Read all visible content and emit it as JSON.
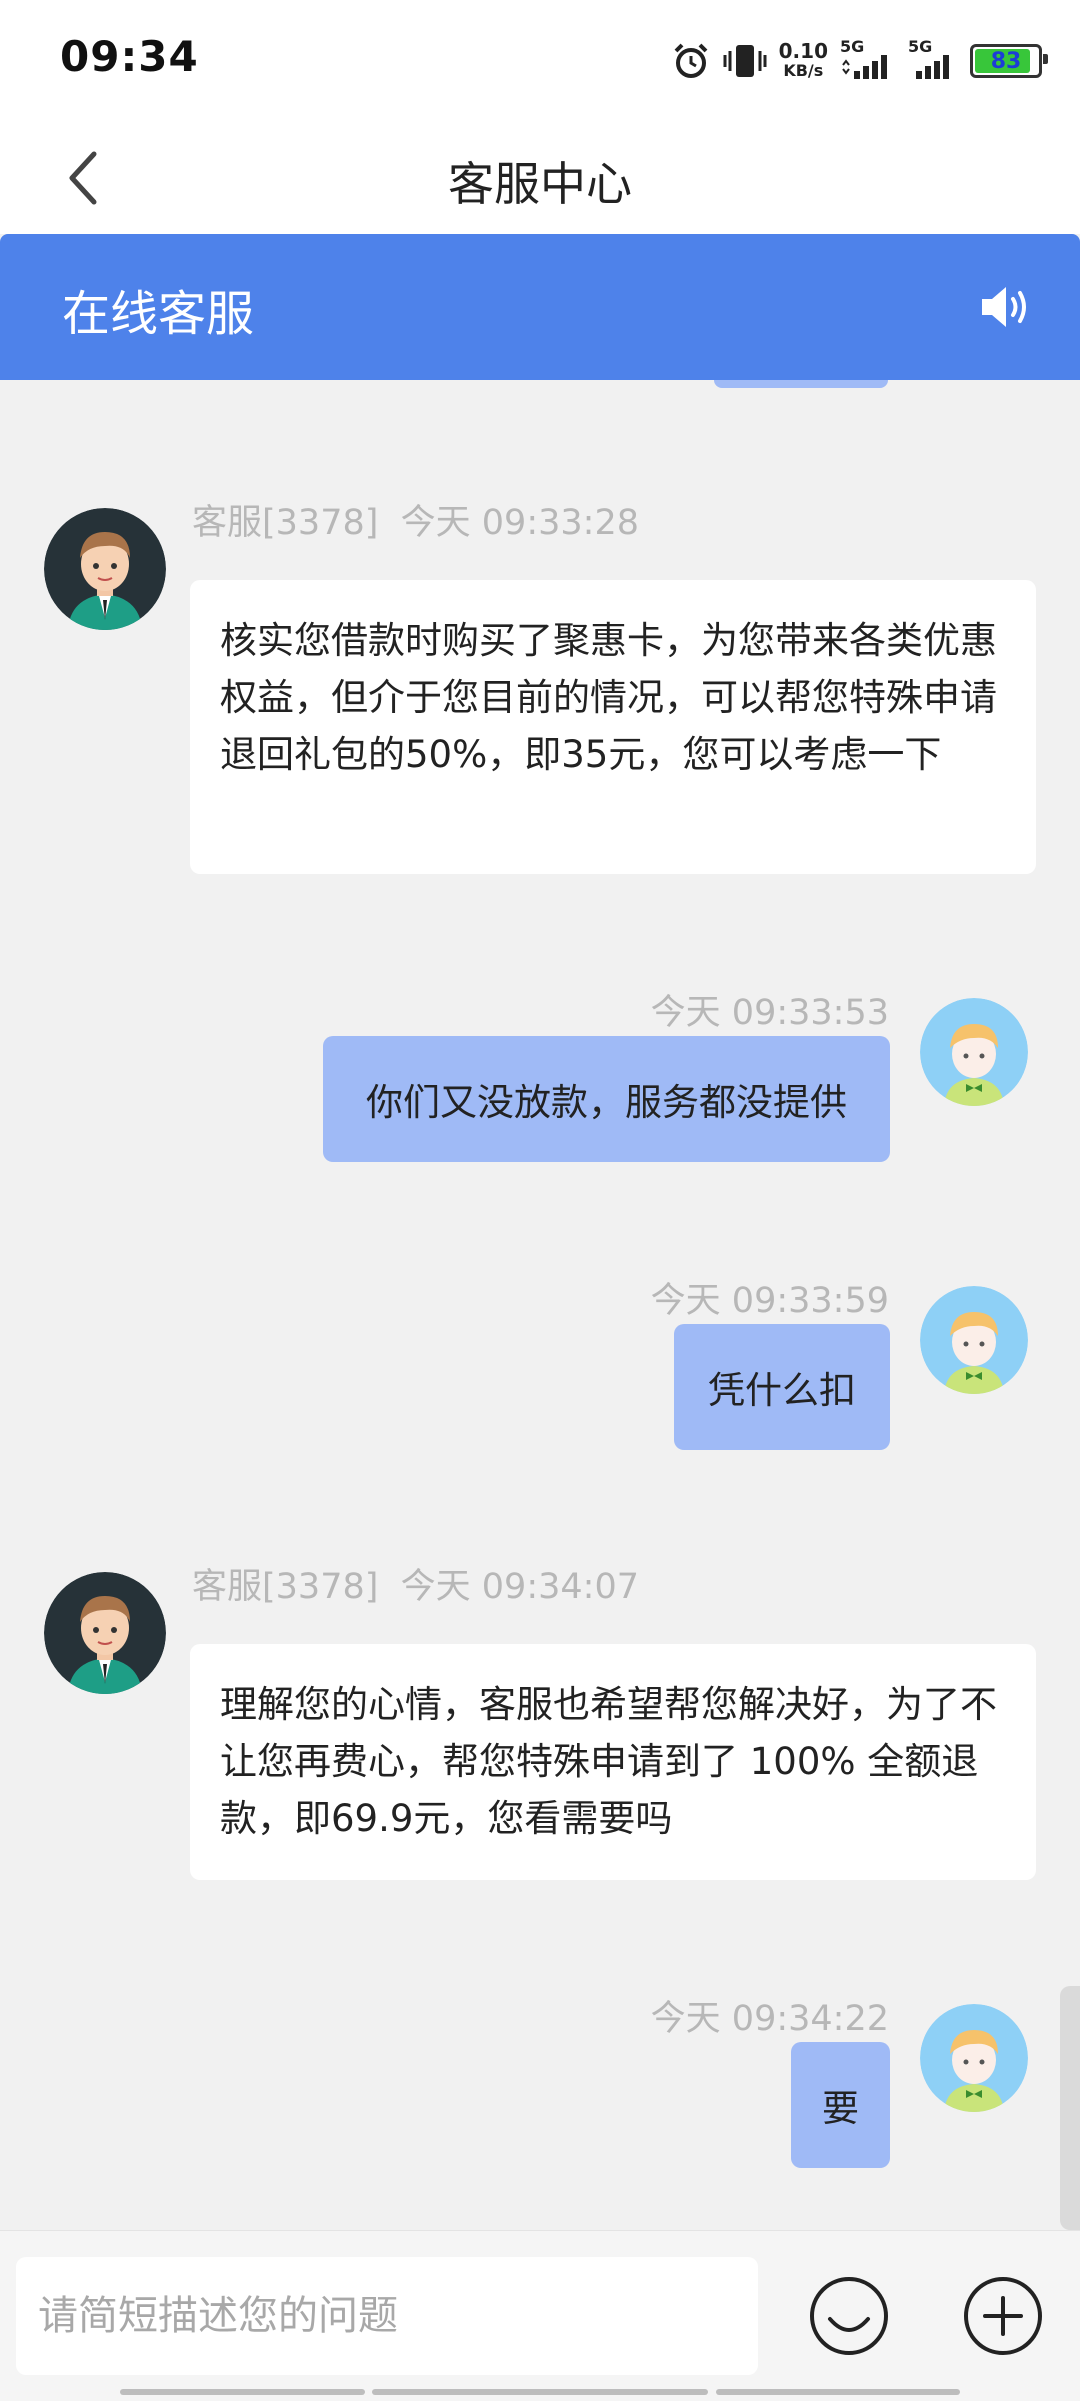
{
  "status_bar": {
    "time": "09:34",
    "net_speed_value": "0.10",
    "net_speed_unit": "KB/s",
    "signal1_label": "5G",
    "signal2_label": "5G",
    "battery": "83",
    "icons": [
      "alarm-icon",
      "vibrate-icon",
      "signal-icon",
      "battery-icon"
    ]
  },
  "header": {
    "title": "客服中心"
  },
  "banner": {
    "title": "在线客服"
  },
  "messages": [
    {
      "from": "agent",
      "sender": "客服[3378]",
      "time": "今天 09:33:28",
      "text": "核实您借款时购买了聚惠卡，为您带来各类优惠权益，但介于您目前的情况，可以帮您特殊申请退回礼包的50%，即35元，您可以考虑一下"
    },
    {
      "from": "user",
      "time": "今天 09:33:53",
      "text": "你们又没放款，服务都没提供"
    },
    {
      "from": "user",
      "time": "今天 09:33:59",
      "text": "凭什么扣"
    },
    {
      "from": "agent",
      "sender": "客服[3378]",
      "time": "今天 09:34:07",
      "text": "理解您的心情，客服也希望帮您解决好，为了不让您再费心，帮您特殊申请到了 100% 全额退款，即69.9元，您看需要吗"
    },
    {
      "from": "user",
      "time": "今天 09:34:22",
      "text": "要"
    }
  ],
  "input": {
    "placeholder": "请简短描述您的问题"
  },
  "colors": {
    "accent": "#4e82ea",
    "user_bubble": "#9fbaf6",
    "background": "#f1f1f1"
  }
}
